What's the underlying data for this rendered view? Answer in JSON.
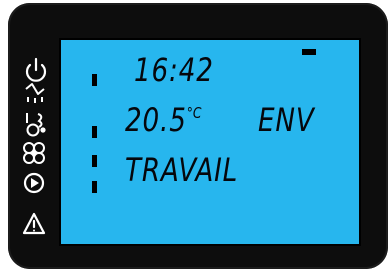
{
  "display": {
    "time": "16:42",
    "temperature": "20.5",
    "temperature_unit": "°C",
    "mode": "ENV",
    "status": "TRAVAIL"
  },
  "icons": [
    "power-icon",
    "heater-icon",
    "ventilation-icon",
    "fan-icon",
    "play-icon",
    "warning-icon"
  ],
  "colors": {
    "lcd_background": "#27b6ee",
    "bezel": "#0d0d0d",
    "icon": "#ffffff",
    "segment": "#05070c"
  }
}
